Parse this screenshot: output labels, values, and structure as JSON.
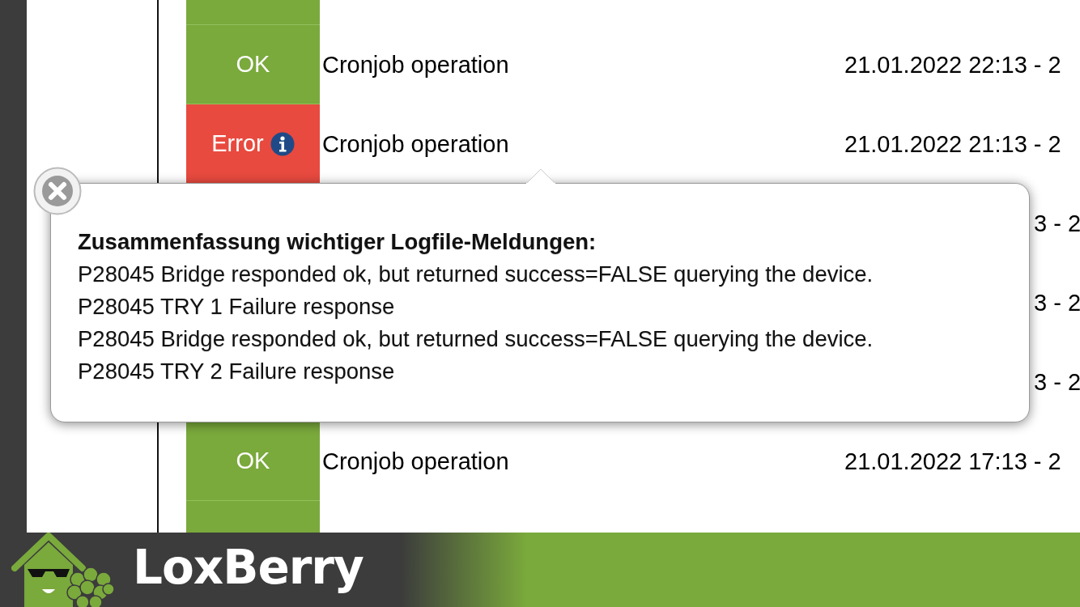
{
  "log_rows": [
    {
      "kind": "entry",
      "color": "#7aa93c"
    },
    {
      "kind": "entry",
      "color": "#7aa93c",
      "status": "OK",
      "info": false,
      "task": "Cronjob operation",
      "time": "21.01.2022 22:13 - 2"
    },
    {
      "kind": "entry",
      "color": "#e84a3f",
      "status": "Error",
      "info": true,
      "task": "Cronjob operation",
      "time": "21.01.2022 21:13 - 2"
    },
    {
      "kind": "covered",
      "time": "3 - 2"
    },
    {
      "kind": "covered",
      "time": "3 - 2"
    },
    {
      "kind": "covered",
      "time": "3 - 2"
    },
    {
      "kind": "entry",
      "color": "#7aa93c",
      "status": "OK",
      "info": false,
      "task": "Cronjob operation",
      "time": "21.01.2022 17:13 - 2"
    },
    {
      "kind": "entry",
      "color": "#7aa93c"
    }
  ],
  "popup": {
    "title": "Zusammenfassung wichtiger Logfile-Meldungen:",
    "lines": [
      "P28045 Bridge responded ok, but returned success=FALSE querying the device.",
      "P28045 TRY 1 Failure response",
      "P28045 Bridge responded ok, but returned success=FALSE querying the device.",
      "P28045 TRY 2 Failure response"
    ]
  },
  "footer": {
    "brand": "LoxBerry"
  }
}
